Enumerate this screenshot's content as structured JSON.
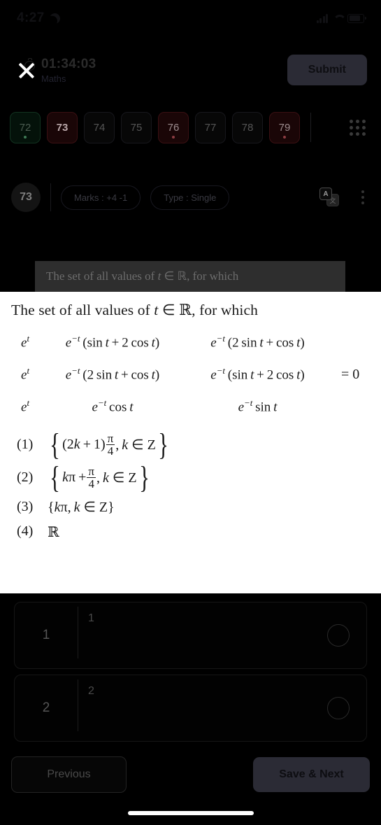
{
  "status_bar": {
    "time": "4:27",
    "moon_icon": "moon-icon",
    "signal_icon": "signal-icon",
    "wifi_icon": "wifi-icon",
    "battery_icon": "battery-icon"
  },
  "header": {
    "close_icon": "close-icon",
    "stopwatch_icon": "stopwatch-icon",
    "timer": "01:34:03",
    "subject": "Maths",
    "submit_label": "Submit"
  },
  "question_chips": {
    "items": [
      {
        "number": "72",
        "state": "answered",
        "has_dot": true
      },
      {
        "number": "73",
        "state": "current",
        "has_dot": false
      },
      {
        "number": "74",
        "state": "neutral",
        "has_dot": false
      },
      {
        "number": "75",
        "state": "neutral",
        "has_dot": false
      },
      {
        "number": "76",
        "state": "marked",
        "has_dot": true
      },
      {
        "number": "77",
        "state": "neutral",
        "has_dot": false
      },
      {
        "number": "78",
        "state": "neutral",
        "has_dot": false
      },
      {
        "number": "79",
        "state": "marked",
        "has_dot": true
      }
    ],
    "grid_icon": "grid-icon"
  },
  "info_bar": {
    "question_number": "73",
    "marks": "Marks : +4  -1",
    "type": "Type : Single",
    "translate_icon": "translate-icon",
    "translate_primary_glyph": "A",
    "translate_secondary_glyph": "文",
    "menu_icon": "more-vertical-icon"
  },
  "question": {
    "stem_prefix": "The set of all values of ",
    "stem_var": "t",
    "stem_member": " ∈ ",
    "stem_set": "ℝ",
    "stem_suffix": ", for which",
    "determinant": {
      "rows": [
        {
          "c1": "e",
          "c1_sup": "t",
          "c2": "e⁻ᵗ (sin t + 2 cos t)",
          "c3": "e⁻ᵗ (2 sin t + cos t)"
        },
        {
          "c1": "e",
          "c1_sup": "t",
          "c2": "e⁻ᵗ (2 sin t + cos t)",
          "c3": "e⁻ᵗ (sin t + 2 cos t)"
        },
        {
          "c1": "e",
          "c1_sup": "t",
          "c2": "e⁻ᵗ cos t",
          "c3": "e⁻ᵗ sin t"
        }
      ],
      "equals": "= 0"
    },
    "options": [
      {
        "label": "(1)",
        "text": "{(2k + 1) π/4 , k ∈ Z}"
      },
      {
        "label": "(2)",
        "text": "{kπ + π/4 , k ∈ Z}"
      },
      {
        "label": "(3)",
        "text": "{kπ, k ∈ Z}"
      },
      {
        "label": "(4)",
        "text": "ℝ"
      }
    ]
  },
  "answer_rows": [
    {
      "index": "1",
      "body_label": "1"
    },
    {
      "index": "2",
      "body_label": "2"
    }
  ],
  "footer": {
    "previous_label": "Previous",
    "save_next_label": "Save & Next"
  },
  "colors": {
    "overlay_background": "#ffffff",
    "page_background": "#000000",
    "submit_button": "#2b2b35",
    "answered_chip": "#04120a",
    "marked_chip": "#1a0607"
  }
}
